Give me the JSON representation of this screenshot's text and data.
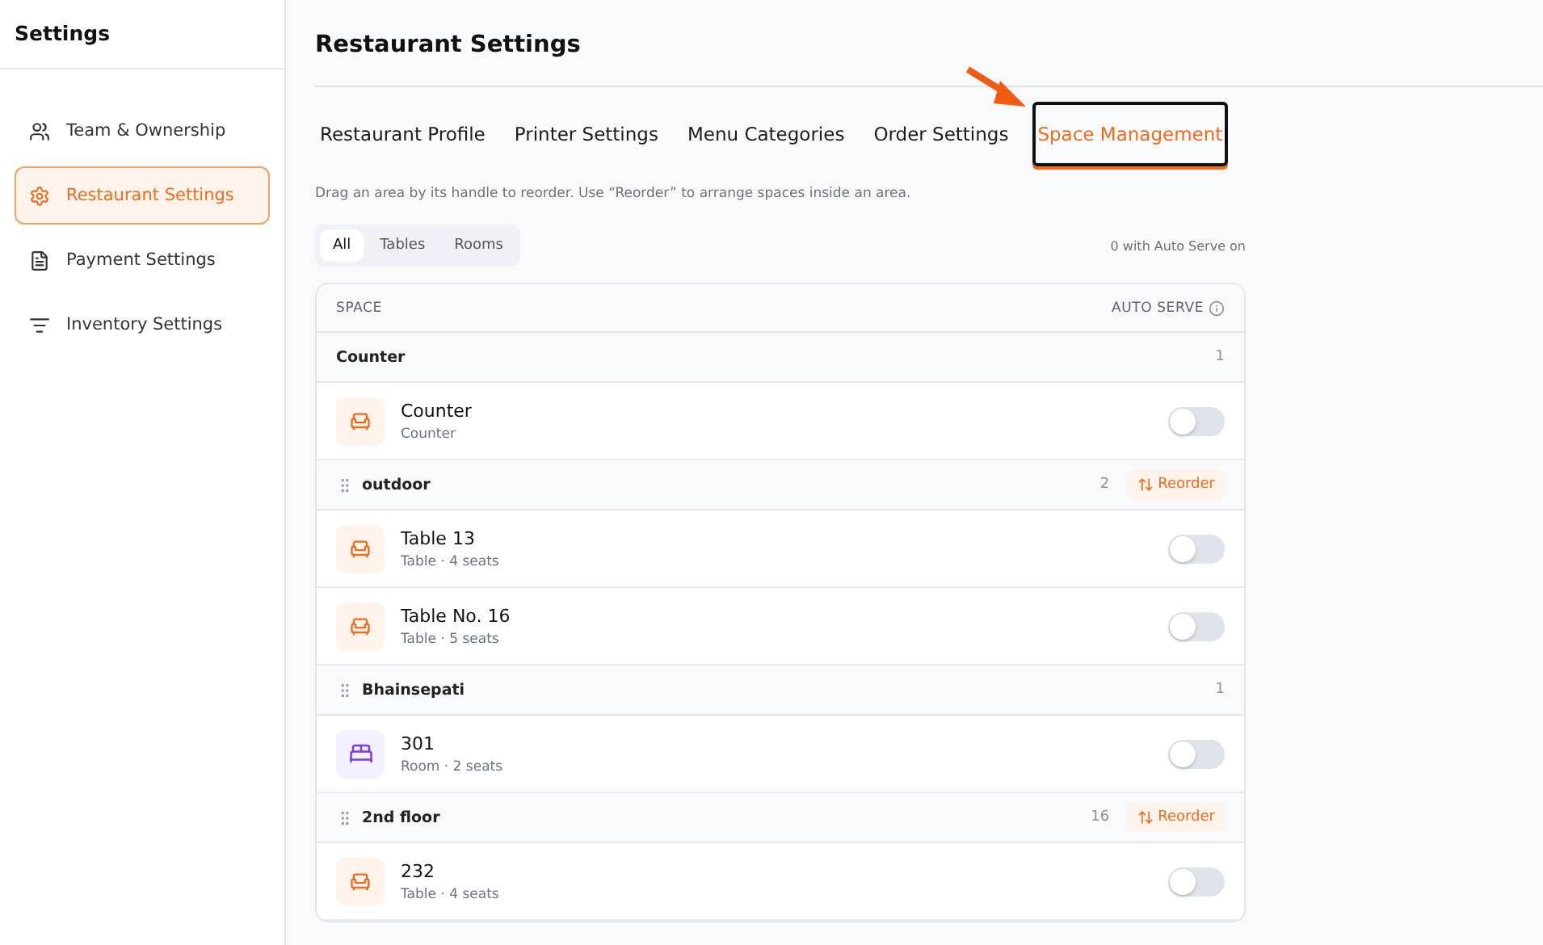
{
  "sidebar": {
    "title": "Settings",
    "items": [
      {
        "label": "Team & Ownership",
        "selected": false
      },
      {
        "label": "Restaurant Settings",
        "selected": true
      },
      {
        "label": "Payment Settings",
        "selected": false
      },
      {
        "label": "Inventory Settings",
        "selected": false
      }
    ]
  },
  "page_title": "Restaurant Settings",
  "tabs": [
    {
      "label": "Restaurant Profile",
      "selected": false
    },
    {
      "label": "Printer Settings",
      "selected": false
    },
    {
      "label": "Menu Categories",
      "selected": false
    },
    {
      "label": "Order Settings",
      "selected": false
    },
    {
      "label": "Space Management",
      "selected": true
    }
  ],
  "hint": "Drag an area by its handle to reorder. Use “Reorder” to arrange spaces inside an area.",
  "filters": [
    {
      "label": "All",
      "selected": true
    },
    {
      "label": "Tables",
      "selected": false
    },
    {
      "label": "Rooms",
      "selected": false
    }
  ],
  "auto_serve_count": "0 with Auto Serve on",
  "table": {
    "columns": [
      "SPACE",
      "AUTO SERVE"
    ],
    "groups": [
      {
        "name": "Counter",
        "draggable": false,
        "count": "1",
        "spaces": [
          {
            "kind": "table",
            "name": "Counter",
            "detail": "Counter",
            "on": false
          }
        ]
      },
      {
        "name": "outdoor",
        "draggable": true,
        "count": "2",
        "reorder": "Reorder",
        "spaces": [
          {
            "kind": "table",
            "name": "Table 13",
            "detail": "Table · 4 seats",
            "on": false
          },
          {
            "kind": "table",
            "name": "Table No. 16",
            "detail": "Table · 5 seats",
            "on": false
          }
        ]
      },
      {
        "name": "Bhainsepati",
        "draggable": true,
        "count": "1",
        "spaces": [
          {
            "kind": "room",
            "name": "301",
            "detail": "Room · 2 seats",
            "on": false
          }
        ]
      },
      {
        "name": "2nd floor",
        "draggable": true,
        "count": "16",
        "reorder": "Reorder",
        "spaces": [
          {
            "kind": "table",
            "name": "232",
            "detail": "Table · 4 seats",
            "on": false
          }
        ]
      }
    ]
  }
}
